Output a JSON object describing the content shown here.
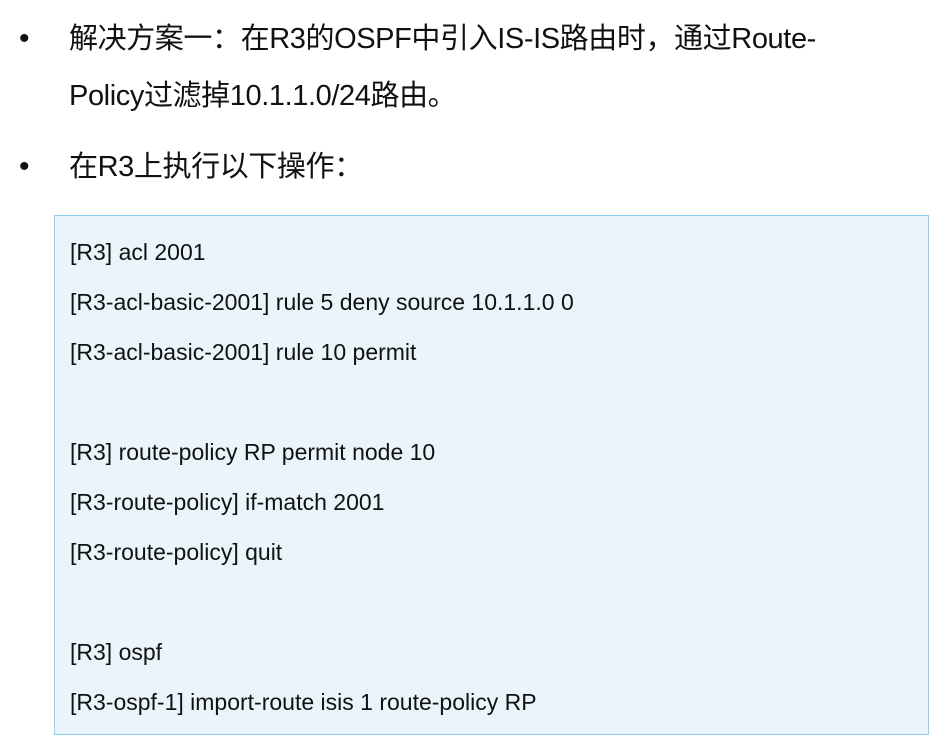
{
  "bullets": [
    {
      "dot": "•",
      "line1": "解决方案一：在R3的OSPF中引入IS-IS路由时，通过Route-",
      "line2": "Policy过滤掉10.1.1.0/24路由。"
    },
    {
      "dot": "•",
      "line1": "在R3上执行以下操作："
    }
  ],
  "code": {
    "lines": [
      "[R3] acl 2001",
      "[R3-acl-basic-2001] rule 5 deny source 10.1.1.0 0",
      "[R3-acl-basic-2001] rule 10 permit",
      "",
      "[R3] route-policy RP permit node 10",
      "[R3-route-policy] if-match 2001",
      "[R3-route-policy] quit",
      "",
      "[R3] ospf",
      "[R3-ospf-1] import-route isis 1 route-policy RP"
    ]
  },
  "colors": {
    "code_background": "#eaf5fb",
    "code_border": "#8fd3ef",
    "text": "#111111"
  }
}
